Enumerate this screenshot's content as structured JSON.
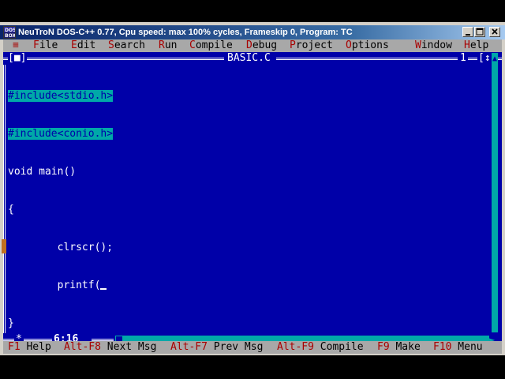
{
  "window": {
    "title": "NeuTroN DOS-C++ 0.77, Cpu speed: max 100% cycles, Frameskip  0, Program:     TC",
    "icon": "dosbox-icon"
  },
  "menu": {
    "system": "≡",
    "items": [
      {
        "hot": "F",
        "rest": "ile"
      },
      {
        "hot": "E",
        "rest": "dit"
      },
      {
        "hot": "S",
        "rest": "earch"
      },
      {
        "hot": "R",
        "rest": "un"
      },
      {
        "hot": "C",
        "rest": "ompile"
      },
      {
        "hot": "D",
        "rest": "ebug"
      },
      {
        "hot": "P",
        "rest": "roject"
      },
      {
        "hot": "O",
        "rest": "ptions"
      },
      {
        "hot": "W",
        "rest": "indow"
      },
      {
        "hot": "H",
        "rest": "elp"
      }
    ]
  },
  "editor": {
    "close_box": "[■]",
    "filename": "BASIC.C",
    "window_number": "1",
    "zoom_box": "[↕]",
    "cursor_position": "6:16",
    "lines": [
      {
        "text": "#include<stdio.h>",
        "highlight": true
      },
      {
        "text": "#include<conio.h>",
        "highlight": true
      },
      {
        "text": "void main()",
        "highlight": false
      },
      {
        "text": "{",
        "highlight": false
      },
      {
        "text": "        clrscr();",
        "highlight": false
      },
      {
        "text": "        printf(",
        "highlight": false
      },
      {
        "text": "}",
        "highlight": false
      }
    ]
  },
  "statusbar": {
    "items": [
      {
        "key": "F1",
        "label": " Help"
      },
      {
        "key": "Alt-F8",
        "label": " Next Msg"
      },
      {
        "key": "Alt-F7",
        "label": " Prev Msg"
      },
      {
        "key": "Alt-F9",
        "label": " Compile"
      },
      {
        "key": "F9",
        "label": " Make"
      },
      {
        "key": "F10",
        "label": " Menu"
      }
    ]
  },
  "colors": {
    "screen_bg": "#0000a8",
    "menu_bg": "#a8a8a8",
    "hotkey": "#a80000",
    "selection": "#00a8a8",
    "text": "#ffffff"
  }
}
